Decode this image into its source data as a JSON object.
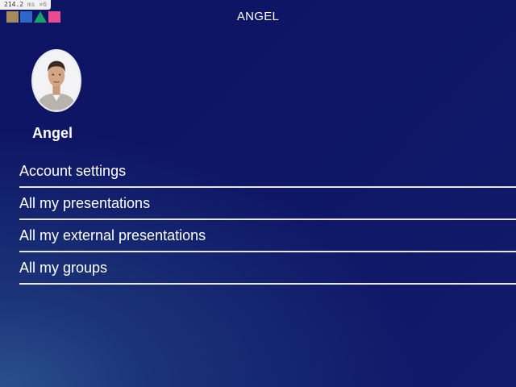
{
  "perf": {
    "value": "214.2",
    "unit": "ms",
    "multiplier": "×6"
  },
  "header": {
    "title": "ANGEL"
  },
  "profile": {
    "name": "Angel"
  },
  "menu": {
    "items": [
      {
        "label": "Account settings"
      },
      {
        "label": "All my presentations"
      },
      {
        "label": "All my external presentations"
      },
      {
        "label": "All my groups"
      }
    ]
  },
  "colors": {
    "background_top": "#0d1464",
    "background_glow": "#2a4f8e",
    "divider": "#e6e6f0",
    "logo": [
      "#a48a5c",
      "#2f67c7",
      "#1aa06a",
      "#e64c92"
    ]
  },
  "icons": {
    "logo": "elan-logo-icon",
    "avatar": "user-avatar-photo"
  }
}
